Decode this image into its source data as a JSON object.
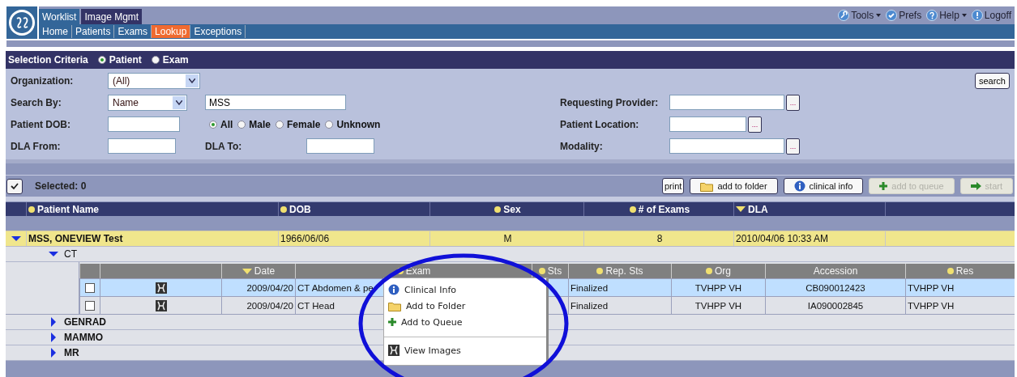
{
  "header": {
    "tabs": [
      {
        "label": "Worklist",
        "selected": false
      },
      {
        "label": "Image Mgmt",
        "selected": true
      }
    ],
    "links": [
      {
        "label": "Tools",
        "kind": "wrench",
        "menu": true
      },
      {
        "label": "Prefs",
        "kind": "check",
        "menu": false
      },
      {
        "label": "Help",
        "kind": "help",
        "menu": true
      },
      {
        "label": "Logoff",
        "kind": "power",
        "menu": false
      }
    ],
    "nav": [
      {
        "label": "Home",
        "selected": false
      },
      {
        "label": "Patients",
        "selected": false
      },
      {
        "label": "Exams",
        "selected": false
      },
      {
        "label": "Lookup",
        "selected": true
      },
      {
        "label": "Exceptions",
        "selected": false
      }
    ]
  },
  "criteria": {
    "title": "Selection Criteria",
    "modes": [
      {
        "label": "Patient",
        "selected": true
      },
      {
        "label": "Exam",
        "selected": false
      }
    ],
    "organization": {
      "label": "Organization:",
      "value": "(All)"
    },
    "search_by": {
      "label": "Search By:",
      "value": "Name",
      "text": "MSS"
    },
    "patient_dob": {
      "label": "Patient DOB:"
    },
    "sex": [
      {
        "label": "All",
        "selected": true
      },
      {
        "label": "Male",
        "selected": false
      },
      {
        "label": "Female",
        "selected": false
      },
      {
        "label": "Unknown",
        "selected": false
      }
    ],
    "dla_from": {
      "label": "DLA From:"
    },
    "dla_to": {
      "label": "DLA To:"
    },
    "requesting_provider": {
      "label": "Requesting Provider:",
      "browse": "..."
    },
    "patient_location": {
      "label": "Patient Location:",
      "browse": "..."
    },
    "modality": {
      "label": "Modality:",
      "browse": "..."
    },
    "search_button": "search"
  },
  "toolbar": {
    "selected": "Selected: 0",
    "buttons": [
      {
        "label": "print",
        "kind": "plain",
        "disabled": false
      },
      {
        "label": "add to folder",
        "kind": "folder",
        "disabled": false
      },
      {
        "label": "clinical info",
        "kind": "info",
        "disabled": false
      },
      {
        "label": "add to queue",
        "kind": "plus",
        "disabled": true
      },
      {
        "label": "start",
        "kind": "arrow",
        "disabled": true
      }
    ]
  },
  "patients": {
    "columns": [
      {
        "label": "Patient Name",
        "kind": "dot"
      },
      {
        "label": "DOB",
        "kind": "dot"
      },
      {
        "label": "Sex",
        "kind": "dot"
      },
      {
        "label": "# of Exams",
        "kind": "dot"
      },
      {
        "label": "DLA",
        "kind": "down"
      }
    ],
    "rows": [
      {
        "expanded": true,
        "cells": [
          "MSS, ONEVIEW Test",
          "1966/06/06",
          "M",
          "8",
          "2010/04/06 10:33 AM"
        ],
        "groups": [
          {
            "name": "CT",
            "expanded": true,
            "columns": [
              {
                "label": "Date",
                "kind": "down"
              },
              {
                "label": "Exam",
                "kind": "dot"
              },
              {
                "label": "Sts",
                "kind": "dot"
              },
              {
                "label": "Rep. Sts",
                "kind": "dot"
              },
              {
                "label": "Org",
                "kind": "dot"
              },
              {
                "label": "Accession",
                "kind": "plain"
              },
              {
                "label": "Res",
                "kind": "dot"
              }
            ],
            "exams": [
              {
                "selected": true,
                "checked": false,
                "date": "2009/04/20",
                "exam": "CT Abdomen & pe",
                "rep_sts": "Finalized",
                "org": "TVHPP VH",
                "accession": "CB090012423",
                "res": "TVHPP VH"
              },
              {
                "selected": false,
                "checked": false,
                "date": "2009/04/20",
                "exam": "CT Head",
                "rep_sts": "Finalized",
                "org": "TVHPP VH",
                "accession": "IA090002845",
                "res": "TVHPP VH"
              }
            ]
          },
          {
            "name": "GENRAD",
            "expanded": false
          },
          {
            "name": "MAMMO",
            "expanded": false
          },
          {
            "name": "MR",
            "expanded": false
          }
        ]
      }
    ]
  },
  "context_menu": {
    "items": [
      {
        "label": "Clinical Info",
        "kind": "info",
        "separated": false
      },
      {
        "label": "Add to Folder",
        "kind": "folder",
        "separated": false
      },
      {
        "label": "Add to Queue",
        "kind": "plus",
        "separated": false
      },
      {
        "label": "View Images",
        "kind": "image",
        "separated": true
      }
    ]
  }
}
